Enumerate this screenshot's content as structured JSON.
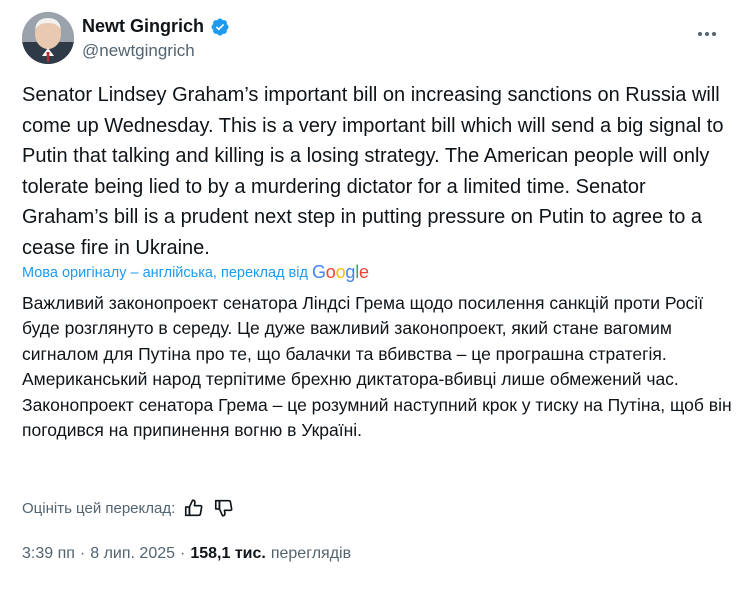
{
  "author": {
    "display_name": "Newt Gingrich",
    "handle": "@newtgingrich",
    "verified_color": "#1d9bf0"
  },
  "icons": {
    "verified": "verified-badge-icon",
    "more": "more-options-icon",
    "thumbs_up": "thumbs-up-icon",
    "thumbs_down": "thumbs-down-icon"
  },
  "tweet": {
    "text": "Senator Lindsey Graham’s important bill on increasing sanctions on Russia will come up Wednesday. This is a very important bill which will send a big signal to Putin that talking and killing is a losing strategy. The American people will only tolerate being lied to by a murdering dictator for a limited time. Senator Graham’s bill is a prudent next step in putting pressure on Putin to agree to a cease fire in Ukraine."
  },
  "translation": {
    "source_label": "Мова оригіналу – англійська, переклад від",
    "provider": "Google",
    "text": "Важливий законопроект сенатора Ліндсі Грема щодо посилення санкцій проти Росії буде розглянуто в середу. Це дуже важливий законопроект, який стане вагомим сигналом для Путіна про те, що балачки та вбивства – це програшна стратегія. Американський народ терпітиме брехню диктатора-вбивці лише обмежений час. Законопроект сенатора Грема – це розумний наступний крок у тиску на Путіна, щоб він погодився на припинення вогню в Україні.",
    "rate_label": "Оцініть цей переклад:"
  },
  "meta": {
    "time": "3:39 пп",
    "separator": "·",
    "date": "8 лип. 2025",
    "views_count": "158,1 тис.",
    "views_label": "переглядів"
  },
  "colors": {
    "link": "#1d9bf0",
    "secondary_text": "#536471",
    "primary_text": "#0f1419"
  }
}
